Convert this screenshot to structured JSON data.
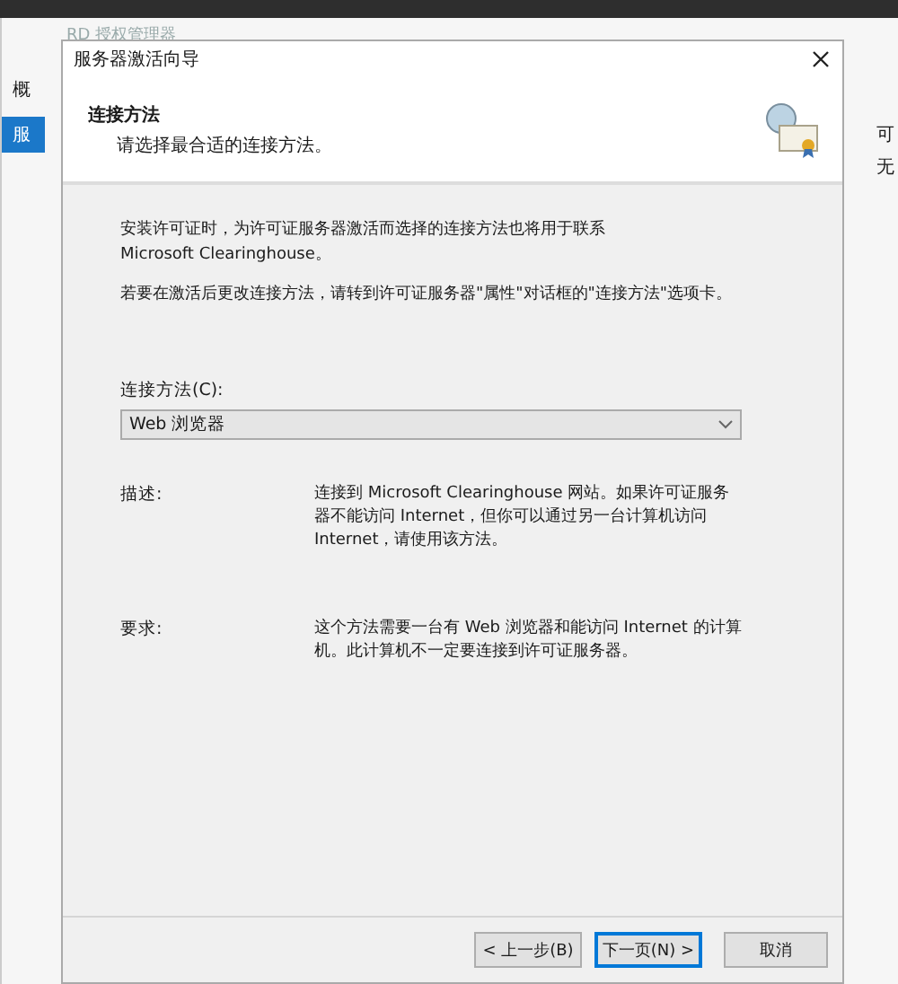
{
  "background_window": {
    "title": "RD 授权管理器",
    "left_labels": [
      "概",
      "服"
    ],
    "right_labels": [
      "可",
      "无"
    ]
  },
  "dialog": {
    "title": "服务器激活向导",
    "header_title": "连接方法",
    "header_subtitle": "请选择最合适的连接方法。",
    "paragraphs": [
      "安装许可证时，为许可证服务器激活而选择的连接方法也将用于联系 Microsoft Clearinghouse。",
      "若要在激活后更改连接方法，请转到许可证服务器\"属性\"对话框的\"连接方法\"选项卡。"
    ],
    "method_label": "连接方法(C):",
    "method_value": "Web 浏览器",
    "details": [
      {
        "label": "描述:",
        "text": "连接到 Microsoft Clearinghouse 网站。如果许可证服务器不能访问 Internet，但你可以通过另一台计算机访问 Internet，请使用该方法。"
      },
      {
        "label": "要求:",
        "text": "这个方法需要一台有 Web 浏览器和能访问 Internet 的计算机。此计算机不一定要连接到许可证服务器。"
      }
    ],
    "buttons": [
      {
        "label": "< 上一步(B)",
        "selected": false
      },
      {
        "label": "下一页(N) >",
        "selected": true
      },
      {
        "label": "取消",
        "selected": false
      }
    ]
  }
}
